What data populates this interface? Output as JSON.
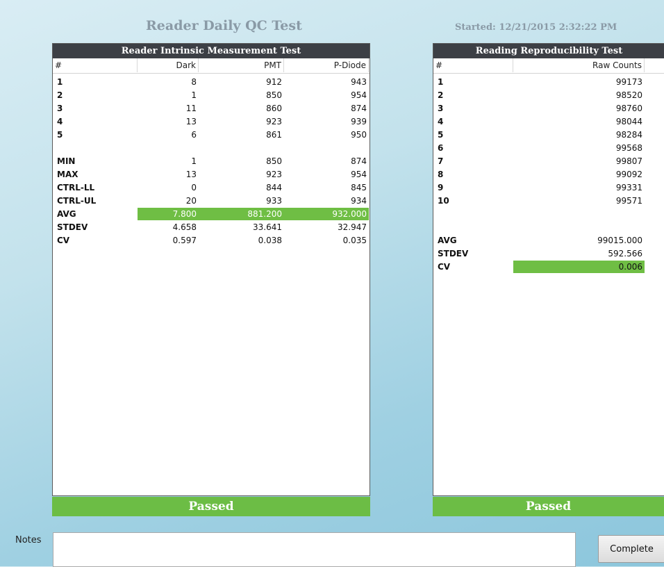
{
  "header": {
    "title": "Reader Daily QC Test",
    "started": "Started: 12/21/2015 2:32:22 PM"
  },
  "intrinsic": {
    "title": "Reader Intrinsic Measurement Test",
    "columns": [
      "#",
      "Dark",
      "PMT",
      "P-Diode"
    ],
    "rows": [
      [
        "1",
        "8",
        "912",
        "943"
      ],
      [
        "2",
        "1",
        "850",
        "954"
      ],
      [
        "3",
        "11",
        "860",
        "874"
      ],
      [
        "4",
        "13",
        "923",
        "939"
      ],
      [
        "5",
        "6",
        "861",
        "950"
      ],
      [
        "",
        "",
        "",
        ""
      ],
      [
        "MIN",
        "1",
        "850",
        "874"
      ],
      [
        "MAX",
        "13",
        "923",
        "954"
      ],
      [
        "CTRL-LL",
        "0",
        "844",
        "845"
      ],
      [
        "CTRL-UL",
        "20",
        "933",
        "934"
      ],
      [
        "AVG",
        "7.800",
        "881.200",
        "932.000"
      ],
      [
        "STDEV",
        "4.658",
        "33.641",
        "32.947"
      ],
      [
        "CV",
        "0.597",
        "0.038",
        "0.035"
      ]
    ],
    "status": "Passed"
  },
  "reproducibility": {
    "title": "Reading Reproducibility Test",
    "columns": [
      "#",
      "Raw Counts"
    ],
    "rows": [
      [
        "1",
        "99173"
      ],
      [
        "2",
        "98520"
      ],
      [
        "3",
        "98760"
      ],
      [
        "4",
        "98044"
      ],
      [
        "5",
        "98284"
      ],
      [
        "6",
        "99568"
      ],
      [
        "7",
        "99807"
      ],
      [
        "8",
        "99092"
      ],
      [
        "9",
        "99331"
      ],
      [
        "10",
        "99571"
      ],
      [
        "",
        ""
      ],
      [
        "",
        ""
      ],
      [
        "AVG",
        "99015.000"
      ],
      [
        "STDEV",
        "592.566"
      ],
      [
        "CV",
        "0.006"
      ]
    ],
    "status": "Passed"
  },
  "footer": {
    "notes_label": "Notes",
    "notes_value": "",
    "complete_label": "Complete"
  },
  "colors": {
    "highlight": "#6fbe44",
    "header_bg": "#3c3f45"
  }
}
